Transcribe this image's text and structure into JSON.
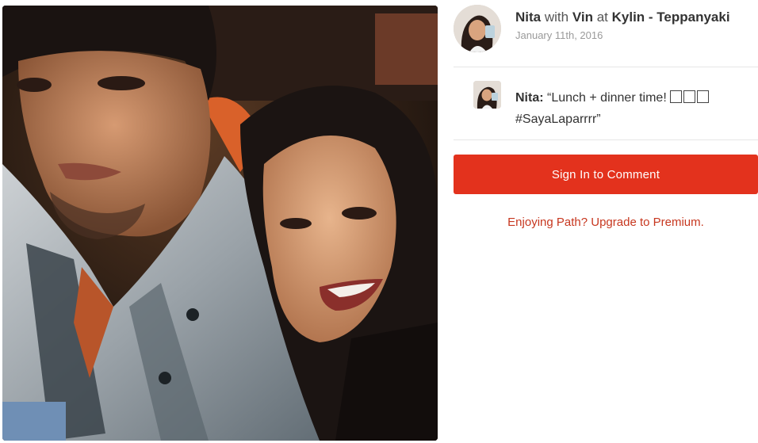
{
  "photo": {
    "subject": "selfie-photo"
  },
  "post": {
    "author": "Nita",
    "with_word": "with",
    "tagged": "Vin",
    "at_word": "at",
    "place": "Kylin - Teppanyaki",
    "date": "January 11th, 2016"
  },
  "comment": {
    "author_label": "Nita:",
    "text_start": "“Lunch + dinner time!",
    "emoji_count": 3,
    "text_end": "#SayaLaparrrr”"
  },
  "actions": {
    "signin_label": "Sign In to Comment",
    "upgrade_label": "Enjoying Path? Upgrade to Premium."
  },
  "colors": {
    "accent": "#e3321d",
    "link": "#c7371f",
    "muted": "#9a9a9a",
    "divider": "#e6e6e6"
  }
}
